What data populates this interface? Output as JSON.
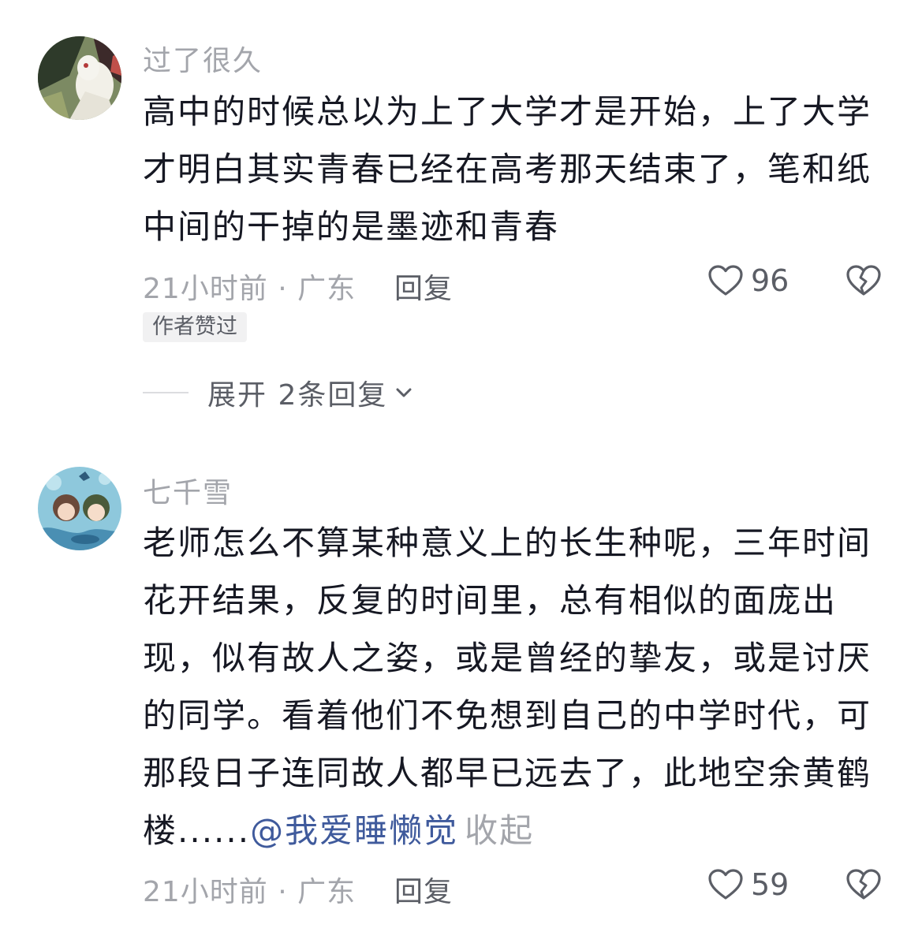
{
  "comments": [
    {
      "username": "过了很久",
      "text": "高中的时候总以为上了大学才是开始，上了大学才明白其实青春已经在高考那天结束了，笔和纸中间的干掉的是墨迹和青春",
      "time_location": "21小时前 · 广东",
      "reply_label": "回复",
      "likes": "96",
      "badge": "作者赞过",
      "expand_label": "展开 2条回复"
    },
    {
      "username": "七千雪",
      "text": "老师怎么不算某种意义上的长生种呢，三年时间花开结果，反复的时间里，总有相似的面庞出现，似有故人之姿，或是曾经的挚友，或是讨厌的同学。看着他们不免想到自己的中学时代，可那段日子连同故人都早已远去了，此地空余黄鹤楼......",
      "mention": "@我爱睡懒觉",
      "collapse_label": "收起",
      "time_location": "21小时前 · 广东",
      "reply_label": "回复",
      "likes": "59"
    }
  ],
  "icons": {
    "like": "heart-outline-icon",
    "dislike": "broken-heart-icon",
    "expand": "chevron-down-icon"
  },
  "colors": {
    "text": "#161823",
    "secondary": "#a3a5ab",
    "action": "#5b5e66",
    "mention": "#3f5a9c",
    "badge_bg": "#f1f1f2"
  }
}
